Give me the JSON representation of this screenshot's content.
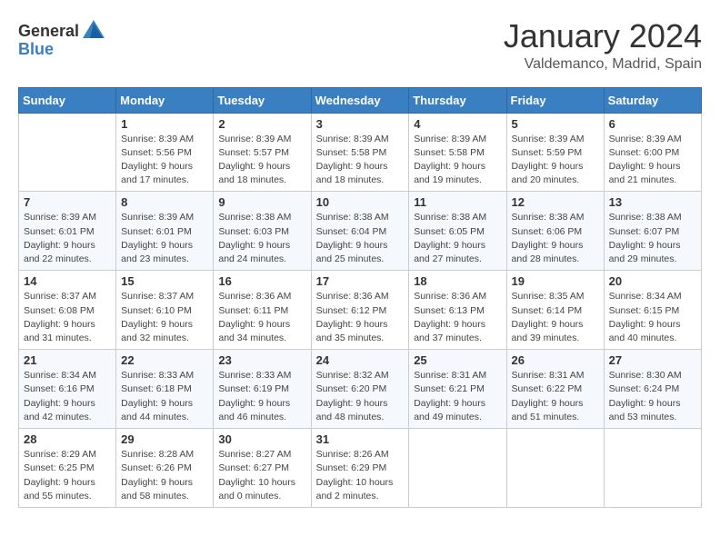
{
  "logo": {
    "general": "General",
    "blue": "Blue"
  },
  "header": {
    "month": "January 2024",
    "location": "Valdemanco, Madrid, Spain"
  },
  "weekdays": [
    "Sunday",
    "Monday",
    "Tuesday",
    "Wednesday",
    "Thursday",
    "Friday",
    "Saturday"
  ],
  "weeks": [
    [
      {
        "day": "",
        "info": ""
      },
      {
        "day": "1",
        "info": "Sunrise: 8:39 AM\nSunset: 5:56 PM\nDaylight: 9 hours\nand 17 minutes."
      },
      {
        "day": "2",
        "info": "Sunrise: 8:39 AM\nSunset: 5:57 PM\nDaylight: 9 hours\nand 18 minutes."
      },
      {
        "day": "3",
        "info": "Sunrise: 8:39 AM\nSunset: 5:58 PM\nDaylight: 9 hours\nand 18 minutes."
      },
      {
        "day": "4",
        "info": "Sunrise: 8:39 AM\nSunset: 5:58 PM\nDaylight: 9 hours\nand 19 minutes."
      },
      {
        "day": "5",
        "info": "Sunrise: 8:39 AM\nSunset: 5:59 PM\nDaylight: 9 hours\nand 20 minutes."
      },
      {
        "day": "6",
        "info": "Sunrise: 8:39 AM\nSunset: 6:00 PM\nDaylight: 9 hours\nand 21 minutes."
      }
    ],
    [
      {
        "day": "7",
        "info": ""
      },
      {
        "day": "8",
        "info": "Sunrise: 8:39 AM\nSunset: 6:01 PM\nDaylight: 9 hours\nand 23 minutes."
      },
      {
        "day": "9",
        "info": "Sunrise: 8:38 AM\nSunset: 6:03 PM\nDaylight: 9 hours\nand 24 minutes."
      },
      {
        "day": "10",
        "info": "Sunrise: 8:38 AM\nSunset: 6:04 PM\nDaylight: 9 hours\nand 25 minutes."
      },
      {
        "day": "11",
        "info": "Sunrise: 8:38 AM\nSunset: 6:05 PM\nDaylight: 9 hours\nand 27 minutes."
      },
      {
        "day": "12",
        "info": "Sunrise: 8:38 AM\nSunset: 6:06 PM\nDaylight: 9 hours\nand 28 minutes."
      },
      {
        "day": "13",
        "info": "Sunrise: 8:38 AM\nSunset: 6:07 PM\nDaylight: 9 hours\nand 29 minutes."
      }
    ],
    [
      {
        "day": "14",
        "info": ""
      },
      {
        "day": "15",
        "info": "Sunrise: 8:37 AM\nSunset: 6:10 PM\nDaylight: 9 hours\nand 32 minutes."
      },
      {
        "day": "16",
        "info": "Sunrise: 8:36 AM\nSunset: 6:11 PM\nDaylight: 9 hours\nand 34 minutes."
      },
      {
        "day": "17",
        "info": "Sunrise: 8:36 AM\nSunset: 6:12 PM\nDaylight: 9 hours\nand 35 minutes."
      },
      {
        "day": "18",
        "info": "Sunrise: 8:36 AM\nSunset: 6:13 PM\nDaylight: 9 hours\nand 37 minutes."
      },
      {
        "day": "19",
        "info": "Sunrise: 8:35 AM\nSunset: 6:14 PM\nDaylight: 9 hours\nand 39 minutes."
      },
      {
        "day": "20",
        "info": "Sunrise: 8:34 AM\nSunset: 6:15 PM\nDaylight: 9 hours\nand 40 minutes."
      }
    ],
    [
      {
        "day": "21",
        "info": ""
      },
      {
        "day": "22",
        "info": "Sunrise: 8:33 AM\nSunset: 6:18 PM\nDaylight: 9 hours\nand 44 minutes."
      },
      {
        "day": "23",
        "info": "Sunrise: 8:33 AM\nSunset: 6:19 PM\nDaylight: 9 hours\nand 46 minutes."
      },
      {
        "day": "24",
        "info": "Sunrise: 8:32 AM\nSunset: 6:20 PM\nDaylight: 9 hours\nand 48 minutes."
      },
      {
        "day": "25",
        "info": "Sunrise: 8:31 AM\nSunset: 6:21 PM\nDaylight: 9 hours\nand 49 minutes."
      },
      {
        "day": "26",
        "info": "Sunrise: 8:31 AM\nSunset: 6:22 PM\nDaylight: 9 hours\nand 51 minutes."
      },
      {
        "day": "27",
        "info": "Sunrise: 8:30 AM\nSunset: 6:24 PM\nDaylight: 9 hours\nand 53 minutes."
      }
    ],
    [
      {
        "day": "28",
        "info": "Sunrise: 8:29 AM\nSunset: 6:25 PM\nDaylight: 9 hours\nand 55 minutes."
      },
      {
        "day": "29",
        "info": "Sunrise: 8:28 AM\nSunset: 6:26 PM\nDaylight: 9 hours\nand 58 minutes."
      },
      {
        "day": "30",
        "info": "Sunrise: 8:27 AM\nSunset: 6:27 PM\nDaylight: 10 hours\nand 0 minutes."
      },
      {
        "day": "31",
        "info": "Sunrise: 8:26 AM\nSunset: 6:29 PM\nDaylight: 10 hours\nand 2 minutes."
      },
      {
        "day": "",
        "info": ""
      },
      {
        "day": "",
        "info": ""
      },
      {
        "day": "",
        "info": ""
      }
    ]
  ],
  "week1_sunday": {
    "day": "7",
    "info": "Sunrise: 8:39 AM\nSunset: 6:01 PM\nDaylight: 9 hours\nand 22 minutes."
  },
  "week2_sunday": {
    "day": "14",
    "info": "Sunrise: 8:37 AM\nSunset: 6:08 PM\nDaylight: 9 hours\nand 31 minutes."
  },
  "week3_sunday": {
    "day": "21",
    "info": "Sunrise: 8:34 AM\nSunset: 6:16 PM\nDaylight: 9 hours\nand 42 minutes."
  }
}
